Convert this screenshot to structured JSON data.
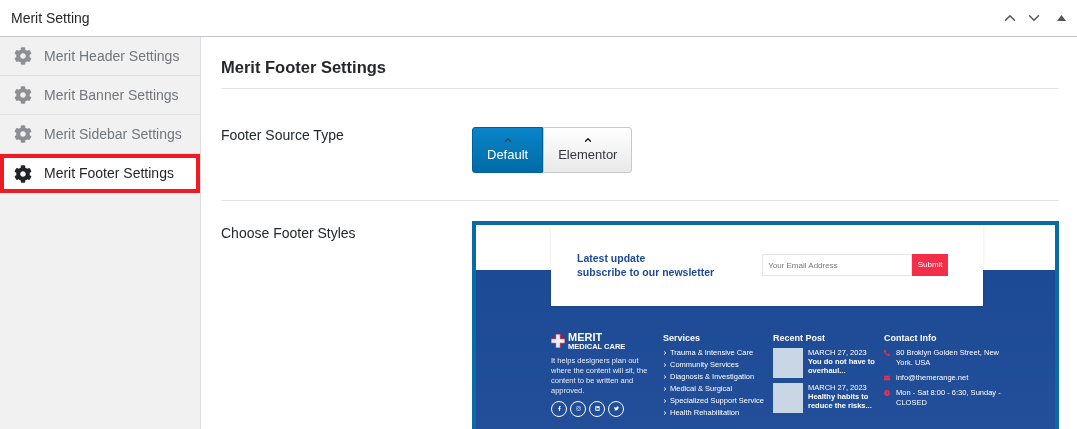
{
  "window": {
    "title": "Merit Setting"
  },
  "sidebar": {
    "items": [
      {
        "label": "Merit Header Settings",
        "selected": false
      },
      {
        "label": "Merit Banner Settings",
        "selected": false
      },
      {
        "label": "Merit Sidebar Settings",
        "selected": false
      },
      {
        "label": "Merit Footer Settings",
        "selected": true
      }
    ]
  },
  "section": {
    "title": "Merit Footer Settings"
  },
  "footer_source_type": {
    "label": "Footer Source Type",
    "options": [
      {
        "label": "Default",
        "selected": true
      },
      {
        "label": "Elementor",
        "selected": false
      }
    ]
  },
  "footer_styles": {
    "label": "Choose Footer Styles",
    "preview": {
      "newsletter": {
        "heading_lines": [
          "Latest update",
          "subscribe to our newsletter"
        ],
        "email_placeholder": "Your Email Address",
        "submit": "Submit"
      },
      "brand": {
        "name": "MERIT",
        "tagline": "MEDICAL CARE",
        "description": "It helps designers plan out where the content will sit, the content to be written and approved."
      },
      "services": {
        "title": "Services",
        "items": [
          "Trauma & Intensive Care",
          "Community Services",
          "Diagnosis & Investigation",
          "Medical & Surgical",
          "Specialized Support Service",
          "Health Rehabilitation"
        ]
      },
      "recent_posts": {
        "title": "Recent Post",
        "posts": [
          {
            "date": "MARCH 27, 2023",
            "title": "You do not have to overhaul..."
          },
          {
            "date": "MARCH 27, 2023",
            "title": "Healthy habits to reduce the risks..."
          }
        ]
      },
      "contact": {
        "title": "Contact Info",
        "items": [
          {
            "kind": "address",
            "text": "80 Broklyn Golden Street, New York. USA"
          },
          {
            "kind": "email",
            "text": "info@themerange.net"
          },
          {
            "kind": "hours",
            "text": "Mon - Sat 8:00 - 6:30, Sunday - CLOSED"
          }
        ]
      }
    }
  }
}
